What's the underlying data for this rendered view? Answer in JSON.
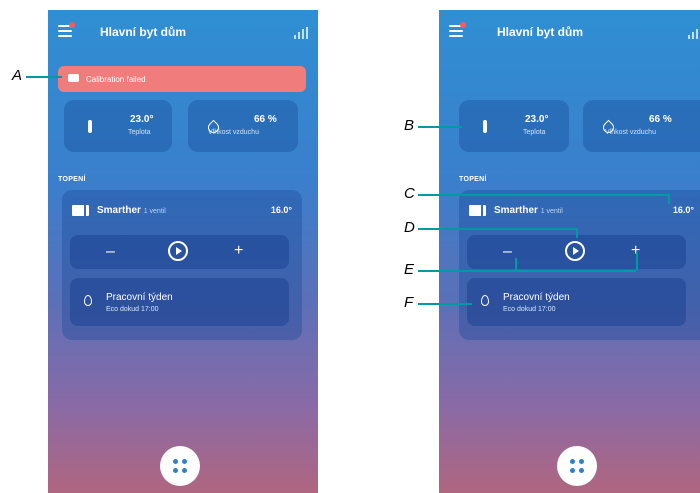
{
  "app": {
    "title": "Hlavní byt dům"
  },
  "alert": {
    "text": "Calibration failed"
  },
  "stats": {
    "temperature": {
      "value": "23.0°",
      "label": "Teplota"
    },
    "humidity": {
      "value": "66 %",
      "label_left": "Vlhkost vzduchu",
      "label_right": "Vlhkost vzduchu"
    }
  },
  "section": {
    "title": "TOPENÍ"
  },
  "device": {
    "name": "Smarther",
    "valves": "1 ventil",
    "temperature": "16.0°"
  },
  "controls": {
    "minus": "–",
    "plus": "+"
  },
  "schedule": {
    "title": "Pracovní týden",
    "subtitle": "Eco dokud 17:00"
  },
  "callouts": {
    "A": "A",
    "B": "B",
    "C": "C",
    "D": "D",
    "E": "E",
    "F": "F"
  },
  "colors": {
    "alert": "#f07d7c",
    "leader": "#009aa0",
    "accent": "#2f7fd0"
  },
  "icons": [
    "menu-icon",
    "signal-icon",
    "calibration-icon",
    "thermometer-icon",
    "humidity-drop-icon",
    "thermostat-device-icon",
    "play-icon",
    "flame-icon",
    "apps-grid-icon"
  ]
}
